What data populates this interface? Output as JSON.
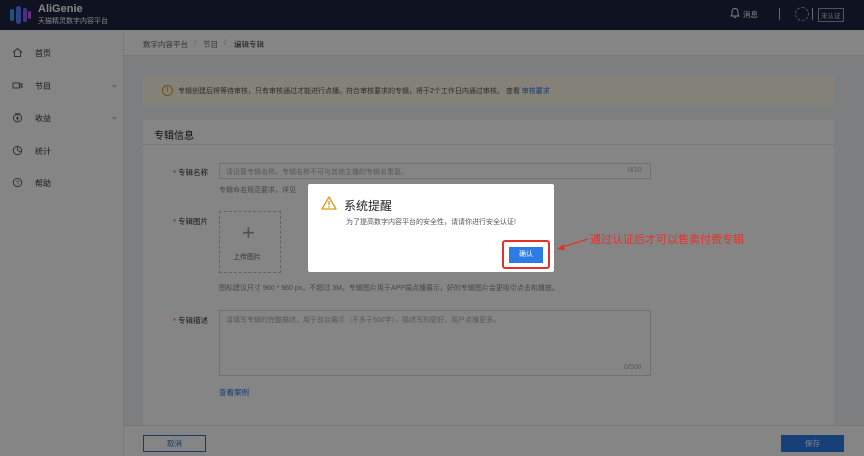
{
  "header": {
    "brand": "AliGenie",
    "brand_sub": "天猫精灵数字内容平台",
    "messages_label": "消息",
    "cert_label": "未认证"
  },
  "sidebar": {
    "items": [
      {
        "label": "首页",
        "icon": "home-icon"
      },
      {
        "label": "节目",
        "icon": "video-icon",
        "expandable": true
      },
      {
        "label": "收益",
        "icon": "money-icon",
        "expandable": true
      },
      {
        "label": "统计",
        "icon": "stats-icon"
      },
      {
        "label": "帮助",
        "icon": "help-icon"
      }
    ]
  },
  "breadcrumb": [
    "数字内容平台",
    "节目",
    "编辑专辑"
  ],
  "notice": {
    "text": "专辑创建后将等待审核，只有审核通过才能进行点播。符合审核要求的专辑，将于2个工作日内通过审核。 查看",
    "link": "审核要求"
  },
  "form": {
    "section_title": "专辑信息",
    "name_label": "专辑名称",
    "name_placeholder": "请设置专辑名称。专辑名称不可与其他主播的专辑名重复。",
    "name_counter": "0/10",
    "name_hint": "专辑命名规范要求，详见",
    "image_label": "专辑图片",
    "upload_label": "上传图片",
    "image_hint": "图标建议尺寸 960 * 960 px，不超过 3M。专辑图片用于APP端点播展示，好的专辑图片会更吸引点击和播放。",
    "desc_label": "专辑描述",
    "desc_placeholder": "请填写专辑的完整描述，用于前台展示（不多于500字），描述写的更好，用户点播更多。",
    "desc_counter": "0/500",
    "case_link": "查看案例"
  },
  "footer": {
    "cancel_label": "取消",
    "save_label": "保存"
  },
  "modal": {
    "title": "系统提醒",
    "body": "为了提高数字内容平台的安全性，请请你进行安全认证!",
    "confirm_label": "确认"
  },
  "annotation": {
    "text": "通过认证后才可以售卖付费专辑",
    "color": "#e3322b"
  },
  "colors": {
    "topbar": "#1b2440",
    "primary": "#2d7be6",
    "warning": "#e09b1c"
  }
}
